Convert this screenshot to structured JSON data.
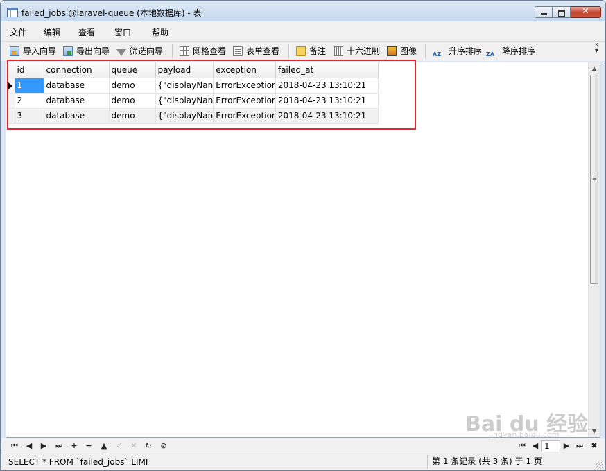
{
  "window": {
    "title": "failed_jobs @laravel-queue (本地数据库) - 表"
  },
  "menu": {
    "items": [
      "文件",
      "编辑",
      "查看",
      "窗口",
      "帮助"
    ]
  },
  "toolbar": {
    "import": "导入向导",
    "export": "导出向导",
    "filter": "筛选向导",
    "grid_view": "网格查看",
    "form_view": "表单查看",
    "memo": "备注",
    "hex": "十六进制",
    "image": "图像",
    "sort_asc": "升序排序",
    "sort_desc": "降序排序",
    "sort_asc_icon": "AZ",
    "sort_desc_icon": "ZA"
  },
  "grid": {
    "columns": [
      "id",
      "connection",
      "queue",
      "payload",
      "exception",
      "failed_at"
    ],
    "rows": [
      [
        "1",
        "database",
        "demo",
        "{\"displayNan",
        "ErrorExceptior",
        "2018-04-23 13:10:21"
      ],
      [
        "2",
        "database",
        "demo",
        "{\"displayNan",
        "ErrorExceptior",
        "2018-04-23 13:10:21"
      ],
      [
        "3",
        "database",
        "demo",
        "{\"displayNan",
        "ErrorExceptior",
        "2018-04-23 13:10:21"
      ]
    ]
  },
  "nav": {
    "page": "1"
  },
  "status": {
    "sql": "SELECT * FROM `failed_jobs` LIMI",
    "records": "第 1 条记录 (共 3 条) 于 1 页"
  },
  "watermark": {
    "text": "Bai du 经验",
    "sub": "jingyan.baidu.com"
  },
  "colors": {
    "selection": "#3399ff",
    "highlight_border": "#e4262b"
  }
}
